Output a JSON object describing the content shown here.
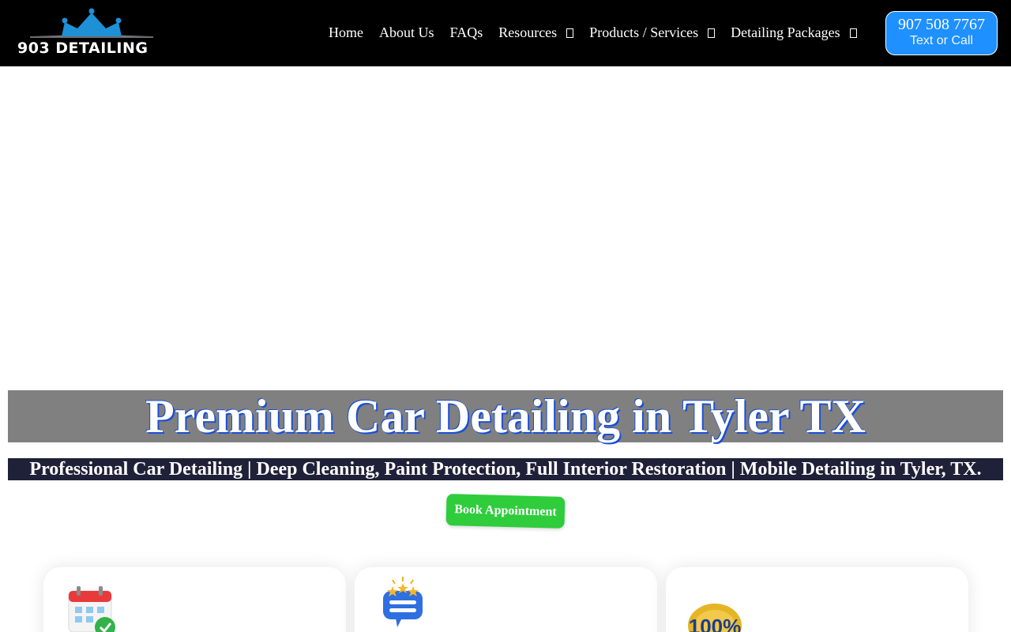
{
  "header": {
    "logo_text": "903 DETAILING",
    "nav": [
      {
        "label": "Home"
      },
      {
        "label": "About Us"
      },
      {
        "label": "FAQs"
      },
      {
        "label": "Resources",
        "dropdown": true
      },
      {
        "label": "Products / Services",
        "dropdown": true
      },
      {
        "label": "Detailing Packages",
        "dropdown": true
      }
    ],
    "cta": {
      "phone": "907 508 7767",
      "sub": "Text or Call"
    }
  },
  "hero": {
    "title": "Premium Car Detailing in Tyler TX",
    "subtitle": "Professional Car Detailing | Deep Cleaning, Paint Protection, Full Interior Restoration | Mobile Detailing in Tyler, TX.",
    "button": "Book Appointment"
  },
  "features": [
    {
      "icon": "calendar-check-icon"
    },
    {
      "icon": "review-stars-icon"
    },
    {
      "icon": "guarantee-badge-icon",
      "badge_text": "100%"
    }
  ],
  "colors": {
    "header_bg": "#000000",
    "accent_blue": "#1e90ff",
    "book_green": "#2fcc3c",
    "banner_gray": "#808080",
    "subtitle_bg": "#1f2138"
  }
}
